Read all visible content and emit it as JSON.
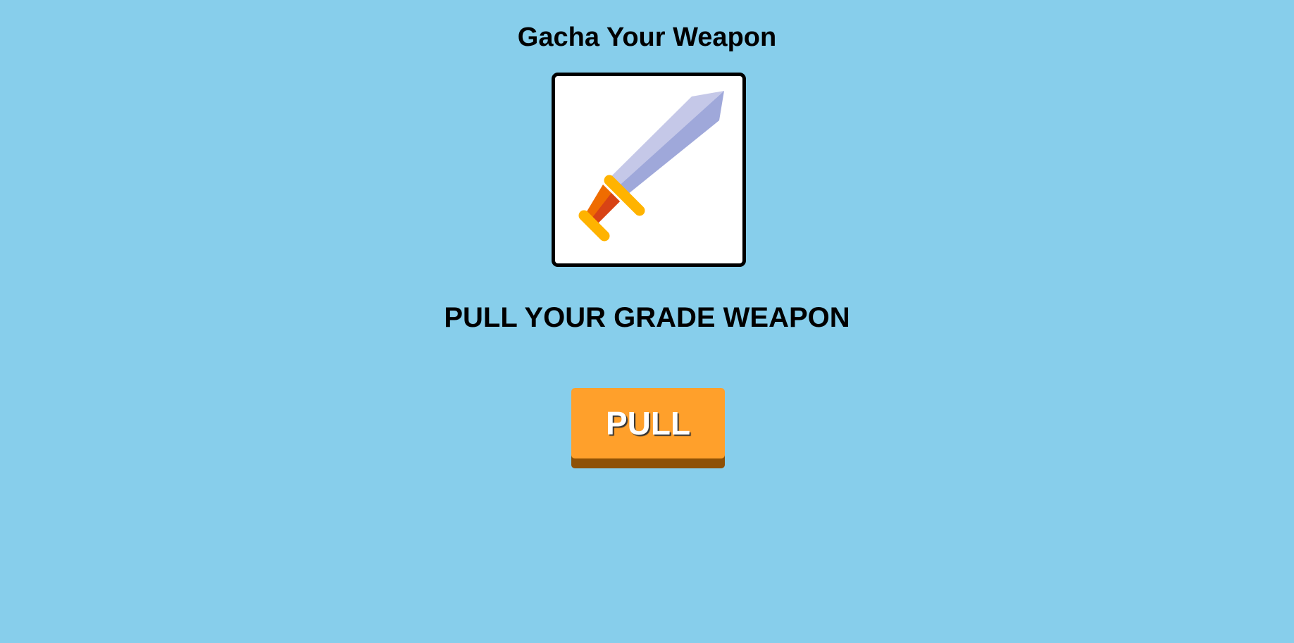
{
  "header": {
    "title": "Gacha Your Weapon"
  },
  "weapon_display": {
    "icon": "sword-icon"
  },
  "main": {
    "subtitle": "PULL YOUR GRADE WEAPON",
    "pull_button_label": "PULL"
  },
  "colors": {
    "background": "#87CEEB",
    "button": "#FFA02B",
    "button_shadow": "#8E5106",
    "blade_light": "#C5C8E8",
    "blade_dark": "#9FA8DA",
    "guard": "#FFB300",
    "grip_light": "#EF6C00",
    "grip_dark": "#D84315"
  }
}
